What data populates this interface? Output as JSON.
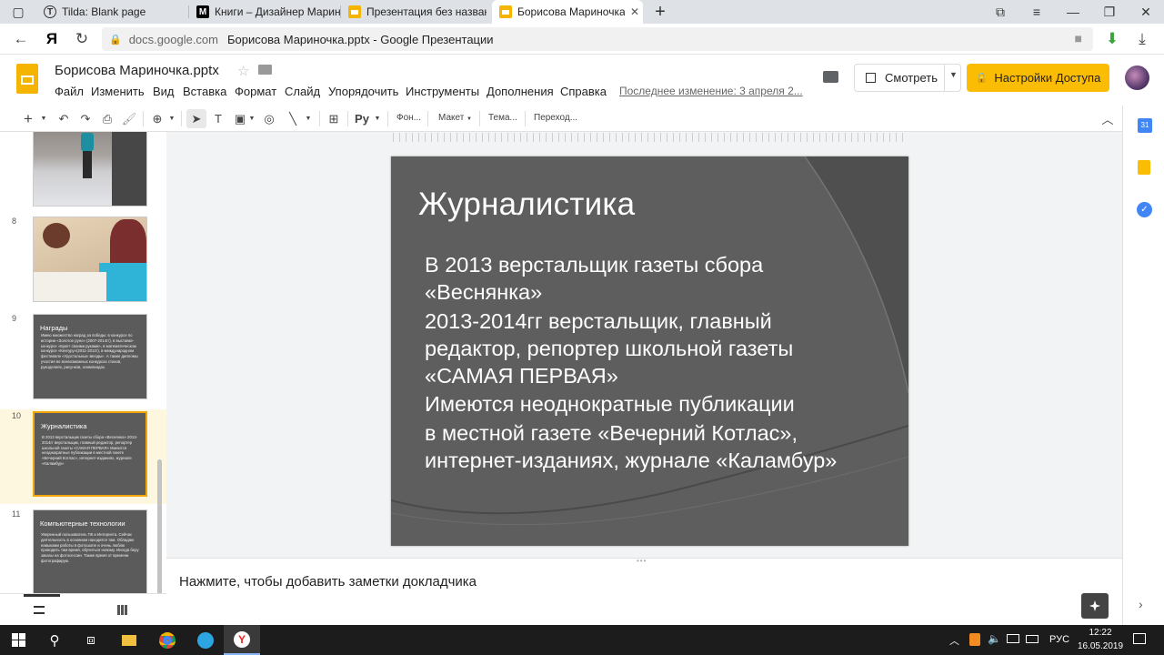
{
  "browser": {
    "tabs": [
      {
        "title": "Tilda: Blank page",
        "icon": "tilda-icon"
      },
      {
        "title": "Книги – Дизайнер Марина",
        "icon": "medium-icon"
      },
      {
        "title": "Презентация без названия",
        "icon": "slides-icon"
      },
      {
        "title": "Борисова Мариночка.pptx",
        "icon": "slides-icon",
        "active": true
      }
    ],
    "new_tab": "+",
    "address": {
      "domain": "docs.google.com",
      "page_title": "Борисова Мариночка.pptx - Google Презентации"
    }
  },
  "docs": {
    "title": "Борисова Мариночка.pptx",
    "menu": [
      "Файл",
      "Изменить",
      "Вид",
      "Вставка",
      "Формат",
      "Слайд",
      "Упорядочить",
      "Инструменты",
      "Дополнения",
      "Справка"
    ],
    "last_edit": "Последнее изменение: 3 апреля 2...",
    "present_label": "Смотреть",
    "share_label": "Настройки Доступа"
  },
  "toolbar": {
    "input_lang": "Ру",
    "background": "Фон...",
    "layout": "Макет",
    "theme": "Тема...",
    "transition": "Переход..."
  },
  "filmstrip": {
    "slides": [
      {
        "num": "8"
      },
      {
        "num": "9",
        "title": "Награды",
        "body": "Имею множество наград за победы: в конкурсе по истории «Золотое руно» (2007-2014гг), в выставке-конкурсе «Букет своими руками», в математическом конкурсе «Кенгуру»(2011-2012г), в международном фестивале «Удостальные звезды». А также дипломы участия во всевозможных конкурсах стихов, рукоделиях, рисунков, олимпиадах."
      },
      {
        "num": "10",
        "title": "Журналистика",
        "body": "В 2013 верстальщик газеты сбора «Веснянка» 2013-2014гг верстальщик, главный редактор, репортер школьной газеты «САМАЯ ПЕРВАЯ» Имеются неоднократные публикации в местной газете «Вечерний Котлас», интернет-изданиях, журнале «Каламбур»",
        "selected": true
      },
      {
        "num": "11",
        "title": "Компьютерные технологии",
        "body": "Уверенный пользователь ПК и Интернета. Сейчас деятельность в основном находится там. Обладаю навыками работы в фотошопе и очень люблю проводить там время, обучиться новому. Иногда беру заказы на фотосессии. Также время от времени фотографирую."
      }
    ]
  },
  "slide": {
    "title": "Журналистика",
    "paragraphs": [
      "В 2013 верстальщик газеты сбора «Веснянка»",
      "2013-2014гг верстальщик, главный редактор, репортер школьной газеты «САМАЯ ПЕРВАЯ»",
      "Имеются неоднократные публикации",
      "в местной газете «Вечерний Котлас», интернет-изданиях, журнале «Каламбур»"
    ]
  },
  "notes_placeholder": "Нажмите, чтобы добавить заметки докладчика",
  "taskbar": {
    "lang": "РУС",
    "time": "12:22",
    "date": "16.05.2019"
  }
}
